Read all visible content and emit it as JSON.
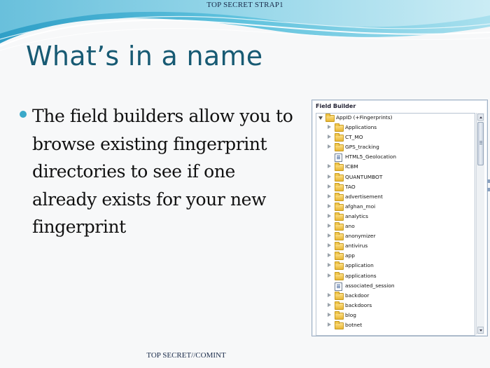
{
  "slide": {
    "classification_top": "TOP SECRET STRAP1",
    "classification_bottom": "TOP SECRET//COMINT",
    "title": "What’s in a name",
    "bullet": "The field builders allow you to browse existing fingerprint directories to see if one already exists for your new fingerprint"
  },
  "field_builder": {
    "title": "Field Builder",
    "tree": [
      {
        "label": "AppID (+Fingerprints)",
        "type": "folder",
        "depth": 0,
        "expanded": true
      },
      {
        "label": "Applications",
        "type": "folder",
        "depth": 1
      },
      {
        "label": "CT_MO",
        "type": "folder",
        "depth": 1
      },
      {
        "label": "GPS_tracking",
        "type": "folder",
        "depth": 1
      },
      {
        "label": "HTML5_Geolocation",
        "type": "field",
        "depth": 1
      },
      {
        "label": "ICBM",
        "type": "folder",
        "depth": 1
      },
      {
        "label": "QUANTUMBOT",
        "type": "folder",
        "depth": 1
      },
      {
        "label": "TAO",
        "type": "folder",
        "depth": 1
      },
      {
        "label": "advertisement",
        "type": "folder",
        "depth": 1
      },
      {
        "label": "afghan_moi",
        "type": "folder",
        "depth": 1
      },
      {
        "label": "analytics",
        "type": "folder",
        "depth": 1
      },
      {
        "label": "ano",
        "type": "folder",
        "depth": 1
      },
      {
        "label": "anonymizer",
        "type": "folder",
        "depth": 1
      },
      {
        "label": "antivirus",
        "type": "folder",
        "depth": 1
      },
      {
        "label": "app",
        "type": "folder",
        "depth": 1
      },
      {
        "label": "application",
        "type": "folder",
        "depth": 1
      },
      {
        "label": "applications",
        "type": "folder",
        "depth": 1
      },
      {
        "label": "associated_session",
        "type": "field",
        "depth": 1
      },
      {
        "label": "backdoor",
        "type": "folder",
        "depth": 1
      },
      {
        "label": "backdoors",
        "type": "folder",
        "depth": 1
      },
      {
        "label": "blog",
        "type": "folder",
        "depth": 1
      },
      {
        "label": "botnet",
        "type": "folder",
        "depth": 1
      }
    ]
  }
}
